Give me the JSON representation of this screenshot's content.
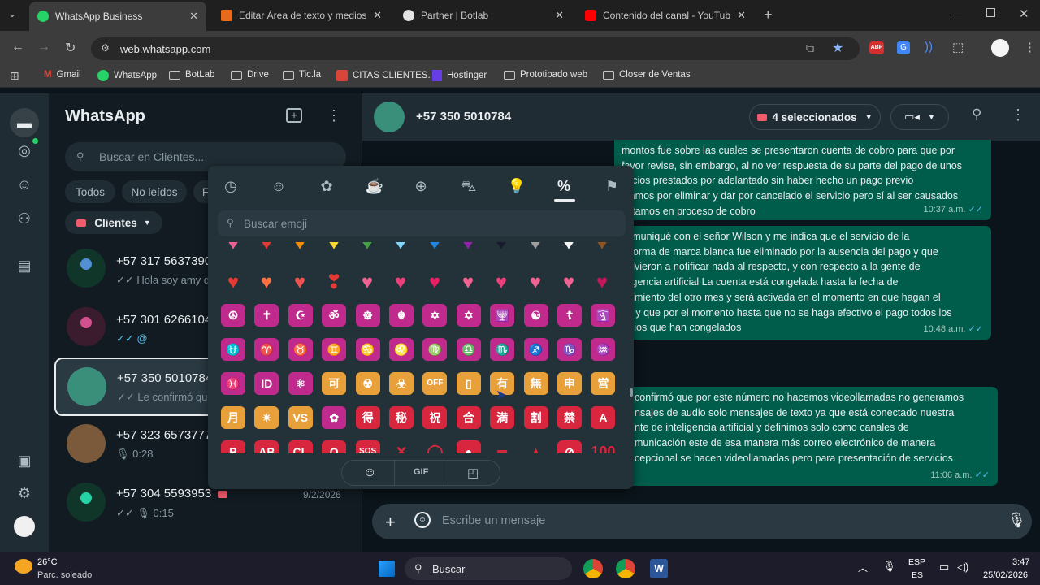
{
  "browser": {
    "tabs": [
      {
        "label": "WhatsApp Business",
        "active": true,
        "icon": "whatsapp-icon"
      },
      {
        "label": "Editar Área de texto y medios: D",
        "active": false,
        "icon": "editor-icon"
      },
      {
        "label": "Partner | Botlab",
        "active": false,
        "icon": "botlab-icon"
      },
      {
        "label": "Contenido del canal - YouTube",
        "active": false,
        "icon": "youtube-icon"
      }
    ],
    "new_tab": "+",
    "url": "web.whatsapp.com",
    "bookmarks": [
      "Gmail",
      "WhatsApp",
      "BotLab",
      "Drive",
      "Tic.la",
      "CITAS CLIENTES.",
      "Hostinger",
      "Prototipado web",
      "Closer de Ventas"
    ]
  },
  "sidebar": {
    "title": "WhatsApp",
    "search_placeholder": "Buscar en Clientes...",
    "filters": [
      "Todos",
      "No leídos",
      "F"
    ],
    "label_filter": "Clientes",
    "chats": [
      {
        "name": "+57 317 5637390",
        "preview": "✓✓ Hola soy amy de",
        "time": ""
      },
      {
        "name": "+57 301 6266104",
        "preview": "✓✓ @",
        "time": ""
      },
      {
        "name": "+57 350 5010784",
        "preview": "✓✓ Le confirmó que",
        "time": ""
      },
      {
        "name": "+57 323 6573777",
        "preview": "🎙 0:28",
        "time": ""
      },
      {
        "name": "+57 304 5593953",
        "preview": "✓✓ 🎙 0:15",
        "time": "9/2/2026"
      }
    ]
  },
  "chat": {
    "contact": "+57 350 5010784",
    "selected_label": "4 seleccionados",
    "messages": [
      {
        "lines": [
          "montos fue sobre las cuales se presentaron cuenta de cobro para que por",
          "favor revise, sin embargo, al no ver respuesta de su parte del pago de unos",
          "rvicios prestados por adelantado sin haber hecho un pago previo",
          "stamos por eliminar y dar por cancelado el servicio pero sí al ser causados",
          "estamos en proceso de cobro"
        ],
        "time": "10:37 a.m."
      },
      {
        "lines": [
          "comuniqué con el señor Wilson y me indica que el servicio de la",
          "taforma de marca blanca fue eliminado por la ausencia del pago y que",
          "volvieron a notificar nada al respecto, y con respecto a la gente de",
          "eligencia artificial La cuenta está congelada hasta la fecha de",
          "ncimiento del otro mes y será activada en el momento en que hagan el",
          "go y que por el momento hasta que no se haga efectivo el pago todos los",
          "vicios que han congelados"
        ],
        "time": "10:48 a.m."
      },
      {
        "lines": [
          "confirmó que por este número no hacemos videollamadas no generamos",
          "nsajes de audio solo mensajes de texto ya que está conectado nuestra",
          "nte de inteligencia artificial y definimos solo como canales de",
          "municación este de esa manera más correo electrónico de manera",
          "cepcional se hacen videollamadas pero para presentación de servicios"
        ],
        "time": "11:06 a.m."
      }
    ],
    "composer_placeholder": "Escribe un mensaje"
  },
  "emoji_picker": {
    "search_placeholder": "Buscar emoji",
    "categories": [
      "recent-icon",
      "smiley-icon",
      "animals-icon",
      "food-icon",
      "activity-icon",
      "travel-icon",
      "objects-icon",
      "symbols-icon",
      "flags-icon"
    ],
    "active_category": "symbols-icon",
    "footer_tabs": [
      "emoji-tab-icon",
      "GIF",
      "sticker-tab-icon"
    ],
    "rows": [
      [
        "💗",
        "❤️",
        "🧡",
        "💛",
        "💚",
        "🩵",
        "💙",
        "💜",
        "🖤",
        "🩶",
        "🤍",
        "🤎"
      ],
      [
        "💔",
        "❤️‍🔥",
        "❤️‍🩹",
        "❣️",
        "💕",
        "💞",
        "💓",
        "💗",
        "💖",
        "💘",
        "💝",
        "💟"
      ],
      [
        "☮️",
        "✝️",
        "☪️",
        "🕉️",
        "☸️",
        "🪯",
        "✡️",
        "🔯",
        "🕎",
        "☯️",
        "☦️",
        "🛐"
      ],
      [
        "⛎",
        "♈",
        "♉",
        "♊",
        "♋",
        "♌",
        "♍",
        "♎",
        "♏",
        "♐",
        "♑",
        "♒"
      ],
      [
        "♓",
        "🆔",
        "⚛️",
        "🉑",
        "☢️",
        "☣️",
        "📴",
        "📳",
        "🈶",
        "🈚",
        "🈸",
        "🈺"
      ],
      [
        "🈷️",
        "✴️",
        "🆚",
        "💮",
        "🉐",
        "㊙️",
        "㊗️",
        "🈴",
        "🈵",
        "🈹",
        "🈲",
        "🅰️"
      ],
      [
        "🅱️",
        "🆎",
        "🆑",
        "🅾️",
        "🆘",
        "❌",
        "⭕",
        "🛑",
        "⛔",
        "📛",
        "🚫",
        "💯"
      ]
    ],
    "symbol_labels": {
      "row2": [
        "☮",
        "✝",
        "☪",
        "ॐ",
        "☸",
        "☬",
        "✡",
        "✡",
        "🕎",
        "☯",
        "☦",
        "🛐"
      ],
      "row3": [
        "⛎",
        "♈",
        "♉",
        "♊",
        "♋",
        "♌",
        "♍",
        "♎",
        "♏",
        "♐",
        "♑",
        "♒"
      ],
      "row4": [
        "♓",
        "ID",
        "⚛",
        "可",
        "☢",
        "☣",
        "OFF",
        "▯",
        "有",
        "無",
        "申",
        "営"
      ],
      "row5": [
        "月",
        "✴",
        "VS",
        "✿",
        "得",
        "秘",
        "祝",
        "合",
        "満",
        "割",
        "禁",
        "A"
      ],
      "row6": [
        "B",
        "AB",
        "CL",
        "O",
        "SOS",
        "✕",
        "◯",
        "●",
        "━",
        "▲",
        "⊘",
        "100"
      ]
    }
  },
  "taskbar": {
    "weather_temp": "26°C",
    "weather_desc": "Parc. soleado",
    "search": "Buscar",
    "lang": "ESP",
    "lang_sub": "ES",
    "time": "3:47",
    "date": "25/02/2026"
  },
  "colors": {
    "accent": "#00a884",
    "bubble_out": "#005c4b",
    "sidebar_bg": "#111b21",
    "panel_bg": "#202c33",
    "symbol_purple": "#c02a8d",
    "symbol_orange": "#e8a13a",
    "symbol_red": "#d7263d"
  }
}
